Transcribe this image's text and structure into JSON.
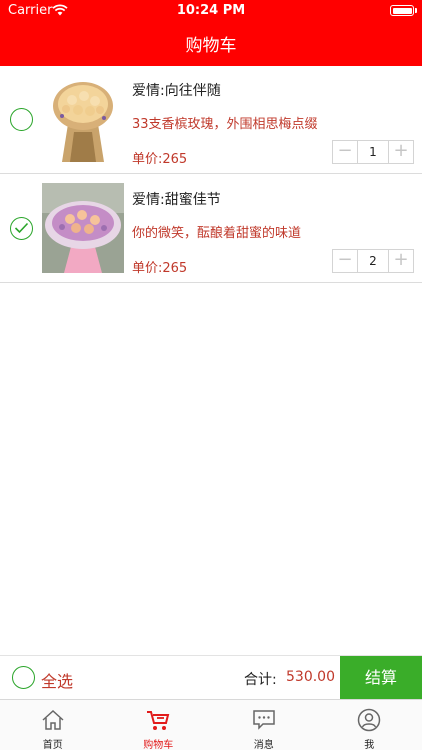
{
  "status_bar": {
    "carrier": "Carrier",
    "time": "10:24 PM"
  },
  "header": {
    "title": "购物车"
  },
  "cart": {
    "items": [
      {
        "name": "爱情:向往伴随",
        "description": "33支香槟玫瑰，外围相思梅点缀",
        "price": "单价:265",
        "quantity": "1",
        "checked": false
      },
      {
        "name": "爱情:甜蜜佳节",
        "description": "你的微笑，酝酿着甜蜜的味道",
        "price": "单价:265",
        "quantity": "2",
        "checked": true
      }
    ]
  },
  "checkout": {
    "select_all_label": "全选",
    "total_label": "合计:",
    "total_value": "530.00",
    "button_label": "结算"
  },
  "tabbar": {
    "tabs": [
      {
        "label": "首页",
        "icon": "home-icon"
      },
      {
        "label": "购物车",
        "icon": "cart-icon",
        "active": true
      },
      {
        "label": "消息",
        "icon": "message-icon"
      },
      {
        "label": "我",
        "icon": "user-icon"
      }
    ]
  },
  "colors": {
    "brand": "#ff0000",
    "price": "#c0392b",
    "check": "#2aa52a",
    "checkout_button": "#3aad29",
    "active_tab": "#e21b1b"
  }
}
